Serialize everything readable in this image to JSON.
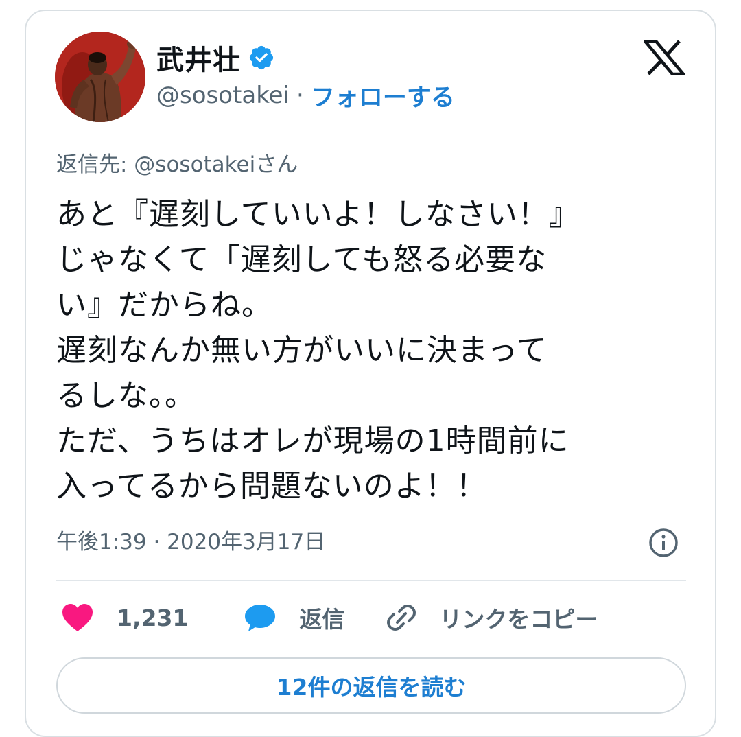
{
  "author": {
    "name": "武井壮",
    "handle": "@sosotakei",
    "separator": "·",
    "follow_label": "フォローする",
    "verified": true
  },
  "icons": {
    "avatar": "avatar-photo",
    "verified": "verified-badge-icon",
    "platform": "x-logo-icon",
    "info": "info-icon",
    "like": "heart-icon",
    "reply": "speech-bubble-icon",
    "copy_link": "link-icon"
  },
  "reply_to": "返信先: @sosotakeiさん",
  "tweet_text": "あと『遅刻していいよ！しなさい！』\nじゃなくて「遅刻しても怒る必要な\nい』だからね。\n遅刻なんか無い方がいいに決まって\nるしな。。\nただ、うちはオレが現場の1時間前に\n入ってるから問題ないのよ！！",
  "timestamp": "午後1:39 · 2020年3月17日",
  "actions": {
    "like_count": "1,231",
    "reply_label": "返信",
    "copy_link_label": "リンクをコピー"
  },
  "read_replies_label": "12件の返信を読む",
  "colors": {
    "accent": "#1d7ed1",
    "like": "#f91880",
    "reply": "#1d9bf0",
    "verified": "#1d9bf0",
    "secondary_text": "#536471"
  }
}
